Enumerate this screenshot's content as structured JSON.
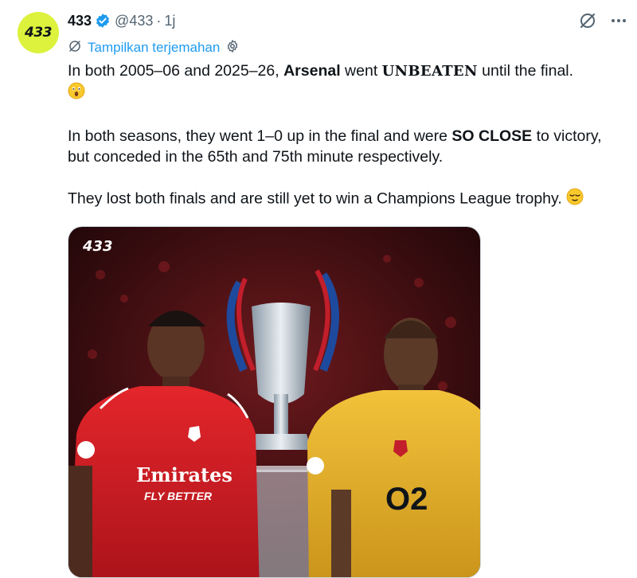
{
  "author": {
    "avatar_text": "433",
    "name": "433",
    "handle": "@433",
    "separator": "·",
    "time": "1j"
  },
  "translate": {
    "label": "Tampilkan terjemahan"
  },
  "tweet": {
    "line1_a": "In both 2005–06 and 2025–26, ",
    "line1_bold": "Arsenal",
    "line1_b": " went ",
    "line1_caps": "UNBEATEN",
    "line1_c": " until the final.",
    "line2_a": "In both seasons, they went 1–0 up in the final and were ",
    "line2_bold": "SO CLOSE",
    "line2_b": " to victory, but conceded in the 65th and 75th minute respectively.",
    "line3": "They lost both finals and are still yet to win a Champions League trophy. "
  },
  "media": {
    "watermark": "433",
    "sponsor_left_1": "Emirates",
    "sponsor_left_2": "FLY BETTER",
    "sponsor_right": "O2"
  },
  "icons": {
    "verified": "verified-badge-icon",
    "translate": "translate-icon",
    "settings": "gear-icon",
    "grok": "grok-icon",
    "more": "more-icon"
  },
  "colors": {
    "accent": "#1d9bf0",
    "avatar_bg": "#dcf23c",
    "muted": "#536471",
    "arsenal_red": "#d4161c",
    "arsenal_yellow": "#e8b321"
  }
}
